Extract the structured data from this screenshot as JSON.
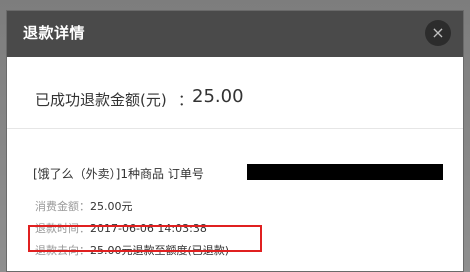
{
  "dialog": {
    "title": "退款详情",
    "close_icon": "×"
  },
  "refund": {
    "amount_label": "已成功退款金额(元)",
    "colon": "：",
    "amount_value": "25.00"
  },
  "order": {
    "summary": "[饿了么（外卖）]1种商品  订单号"
  },
  "details": [
    {
      "label": "消费金额：",
      "value": "25.00元"
    },
    {
      "label": "退款时间：",
      "value": "2017-06-06 14:03:38"
    },
    {
      "label": "退款去向：",
      "value": "25.00元退款至额度(已退款)"
    }
  ],
  "colors": {
    "header_bg": "#4a4a4a",
    "highlight": "#e02020"
  }
}
